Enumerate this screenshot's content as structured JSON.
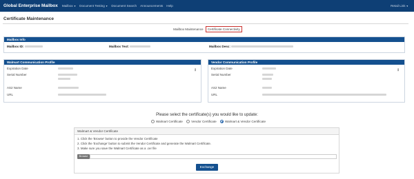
{
  "nav": {
    "brand": "Global Enterprise Mailbox",
    "links": [
      "Mailbox",
      "Document Testing",
      "Document Search",
      "Announcements",
      "Help"
    ],
    "right": "Retail Link"
  },
  "page": {
    "title": "Certificate Maintenance"
  },
  "tabs": {
    "mailbox_maintenance": "Mailbox Maintenance",
    "certificate_connectivity": "Certificate Connectivity"
  },
  "mailbox_info": {
    "header": "Mailbox Info",
    "id_label": "Mailbox ID:",
    "text_label": "Mailbox Text:",
    "desc_label": "Mailbox Desc:"
  },
  "walmart_profile": {
    "header": "Walmart Communication Profile",
    "labels": [
      "Expiration Date",
      "Serial Number",
      "AS2 Name",
      "URL"
    ]
  },
  "vendor_profile": {
    "header": "Vendor Communication Profile",
    "labels": [
      "Expiration Date",
      "Serial Number",
      "AS2 Name",
      "URL"
    ]
  },
  "update": {
    "question": "Please select the certificate(s) you would like to update:",
    "options": [
      "Walmart Certificate",
      "Vendor Certificate",
      "Walmart & Vendor Certificate"
    ],
    "selected": "Walmart & Vendor Certificate"
  },
  "instructions": {
    "header": "Walmart & Vendor Certificate",
    "steps": [
      "1. Click the 'Browse' button to provide the Vendor Certificate",
      "2. Click the 'Exchange' button to submit the Vendor Certificate and generate the Walmart Certificate.",
      "3. Make sure you save the Walmart Certificate as a .cer file"
    ],
    "browse_label": "Browse",
    "exchange_label": "Exchange"
  },
  "colors": {
    "nav_bg": "#0e3f75",
    "panel_header": "#14508f",
    "active_tab_border": "#c9302c"
  }
}
